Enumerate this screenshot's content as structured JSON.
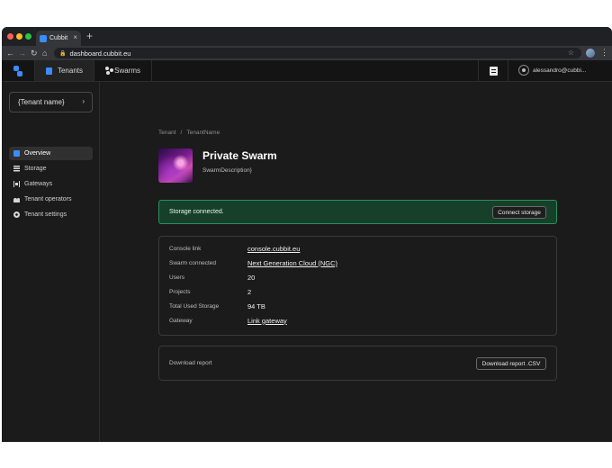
{
  "browser": {
    "tab_title": "Cubbit",
    "tab_close": "×",
    "new_tab": "+",
    "url": "dashboard.cubbit.eu"
  },
  "header": {
    "nav": [
      {
        "label": "Tenants",
        "active": true
      },
      {
        "label": "Swarms",
        "active": false
      }
    ],
    "user_email": "alessandro@cubbi..."
  },
  "sidebar": {
    "tenant_selector": "{Tenant name}",
    "items": [
      {
        "label": "Overview",
        "icon": "grid-icon",
        "active": true
      },
      {
        "label": "Storage",
        "icon": "storage-icon",
        "active": false
      },
      {
        "label": "Gateways",
        "icon": "gateway-icon",
        "active": false
      },
      {
        "label": "Tenant operators",
        "icon": "users-icon",
        "active": false
      },
      {
        "label": "Tenant settings",
        "icon": "gear-icon",
        "active": false
      }
    ]
  },
  "main": {
    "breadcrumb": [
      "Tenant",
      "/",
      "TenantName"
    ],
    "swarm": {
      "title": "Private Swarm",
      "description": "SwarmDescription}"
    },
    "alert": {
      "message": "Storage connected.",
      "button": "Connect storage"
    },
    "info": [
      {
        "label": "Console link",
        "value": "console.cubbit.eu",
        "link": true
      },
      {
        "label": "Swarm connected",
        "value": "Next Generation Cloud (NGC)",
        "link": true
      },
      {
        "label": "Users",
        "value": "20",
        "link": false
      },
      {
        "label": "Projects",
        "value": "2",
        "link": false
      },
      {
        "label": "Total Used Storage",
        "value": "94 TB",
        "link": false
      },
      {
        "label": "Gateway",
        "value": "Link gateway",
        "link": true
      }
    ],
    "report": {
      "label": "Download report",
      "button": "Download report .CSV"
    }
  },
  "colors": {
    "accent": "#3b8cff",
    "success_bg": "#17402a",
    "success_border": "#2c8f5a",
    "background": "#1b1b1b"
  }
}
